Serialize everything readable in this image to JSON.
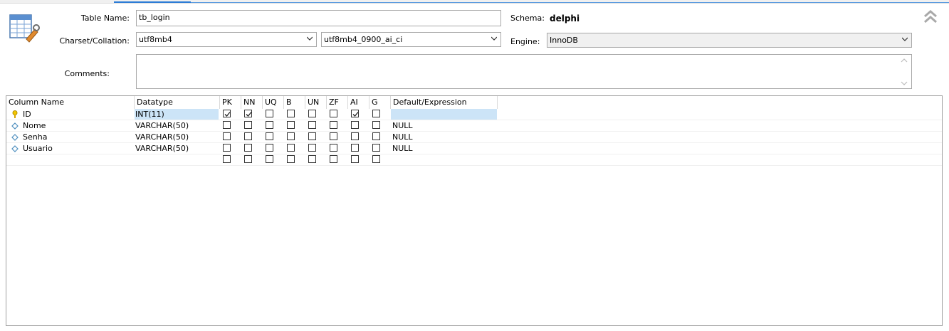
{
  "form": {
    "table_name_label": "Table Name:",
    "table_name_value": "tb_login",
    "schema_label": "Schema:",
    "schema_value": "delphi",
    "charset_label": "Charset/Collation:",
    "charset_value": "utf8mb4",
    "collation_value": "utf8mb4_0900_ai_ci",
    "engine_label": "Engine:",
    "engine_value": "InnoDB",
    "comments_label": "Comments:",
    "comments_value": ""
  },
  "grid": {
    "headers": [
      "Column Name",
      "Datatype",
      "PK",
      "NN",
      "UQ",
      "B",
      "UN",
      "ZF",
      "AI",
      "G",
      "Default/Expression"
    ],
    "rows": [
      {
        "name": "ID",
        "datatype": "INT(11)",
        "icon": "primary-key-icon",
        "flags": [
          true,
          true,
          false,
          false,
          false,
          false,
          true,
          false
        ],
        "default": ""
      },
      {
        "name": "Nome",
        "datatype": "VARCHAR(50)",
        "icon": "column-diamond-icon",
        "flags": [
          false,
          false,
          false,
          false,
          false,
          false,
          false,
          false
        ],
        "default": "NULL"
      },
      {
        "name": "Senha",
        "datatype": "VARCHAR(50)",
        "icon": "column-diamond-icon",
        "flags": [
          false,
          false,
          false,
          false,
          false,
          false,
          false,
          false
        ],
        "default": "NULL"
      },
      {
        "name": "Usuario",
        "datatype": "VARCHAR(50)",
        "icon": "column-diamond-icon",
        "flags": [
          false,
          false,
          false,
          false,
          false,
          false,
          false,
          false
        ],
        "default": "NULL"
      },
      {
        "name": "",
        "datatype": "",
        "icon": "",
        "flags": [
          false,
          false,
          false,
          false,
          false,
          false,
          false,
          false
        ],
        "default": ""
      }
    ]
  },
  "colors": {
    "accent": "#2b7bd6",
    "selection": "#cce4f7"
  }
}
